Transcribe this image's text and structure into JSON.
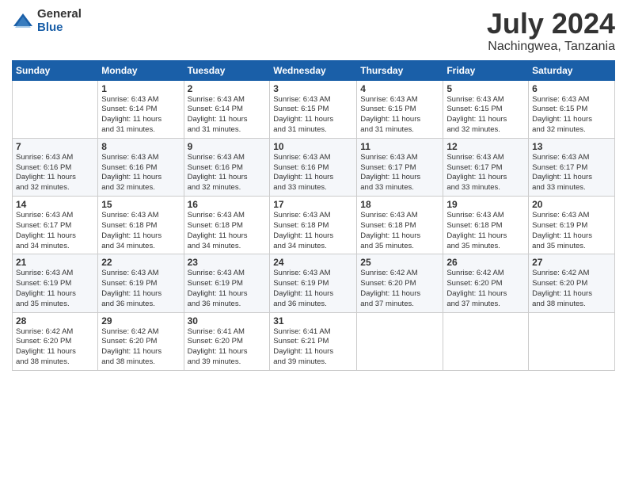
{
  "logo": {
    "general": "General",
    "blue": "Blue"
  },
  "title": "July 2024",
  "location": "Nachingwea, Tanzania",
  "weekdays": [
    "Sunday",
    "Monday",
    "Tuesday",
    "Wednesday",
    "Thursday",
    "Friday",
    "Saturday"
  ],
  "weeks": [
    [
      {
        "day": "",
        "sunrise": "",
        "sunset": "",
        "daylight": ""
      },
      {
        "day": "1",
        "sunrise": "Sunrise: 6:43 AM",
        "sunset": "Sunset: 6:14 PM",
        "daylight": "Daylight: 11 hours and 31 minutes."
      },
      {
        "day": "2",
        "sunrise": "Sunrise: 6:43 AM",
        "sunset": "Sunset: 6:14 PM",
        "daylight": "Daylight: 11 hours and 31 minutes."
      },
      {
        "day": "3",
        "sunrise": "Sunrise: 6:43 AM",
        "sunset": "Sunset: 6:15 PM",
        "daylight": "Daylight: 11 hours and 31 minutes."
      },
      {
        "day": "4",
        "sunrise": "Sunrise: 6:43 AM",
        "sunset": "Sunset: 6:15 PM",
        "daylight": "Daylight: 11 hours and 31 minutes."
      },
      {
        "day": "5",
        "sunrise": "Sunrise: 6:43 AM",
        "sunset": "Sunset: 6:15 PM",
        "daylight": "Daylight: 11 hours and 32 minutes."
      },
      {
        "day": "6",
        "sunrise": "Sunrise: 6:43 AM",
        "sunset": "Sunset: 6:15 PM",
        "daylight": "Daylight: 11 hours and 32 minutes."
      }
    ],
    [
      {
        "day": "7",
        "sunrise": "Sunrise: 6:43 AM",
        "sunset": "Sunset: 6:16 PM",
        "daylight": "Daylight: 11 hours and 32 minutes."
      },
      {
        "day": "8",
        "sunrise": "Sunrise: 6:43 AM",
        "sunset": "Sunset: 6:16 PM",
        "daylight": "Daylight: 11 hours and 32 minutes."
      },
      {
        "day": "9",
        "sunrise": "Sunrise: 6:43 AM",
        "sunset": "Sunset: 6:16 PM",
        "daylight": "Daylight: 11 hours and 32 minutes."
      },
      {
        "day": "10",
        "sunrise": "Sunrise: 6:43 AM",
        "sunset": "Sunset: 6:16 PM",
        "daylight": "Daylight: 11 hours and 33 minutes."
      },
      {
        "day": "11",
        "sunrise": "Sunrise: 6:43 AM",
        "sunset": "Sunset: 6:17 PM",
        "daylight": "Daylight: 11 hours and 33 minutes."
      },
      {
        "day": "12",
        "sunrise": "Sunrise: 6:43 AM",
        "sunset": "Sunset: 6:17 PM",
        "daylight": "Daylight: 11 hours and 33 minutes."
      },
      {
        "day": "13",
        "sunrise": "Sunrise: 6:43 AM",
        "sunset": "Sunset: 6:17 PM",
        "daylight": "Daylight: 11 hours and 33 minutes."
      }
    ],
    [
      {
        "day": "14",
        "sunrise": "Sunrise: 6:43 AM",
        "sunset": "Sunset: 6:17 PM",
        "daylight": "Daylight: 11 hours and 34 minutes."
      },
      {
        "day": "15",
        "sunrise": "Sunrise: 6:43 AM",
        "sunset": "Sunset: 6:18 PM",
        "daylight": "Daylight: 11 hours and 34 minutes."
      },
      {
        "day": "16",
        "sunrise": "Sunrise: 6:43 AM",
        "sunset": "Sunset: 6:18 PM",
        "daylight": "Daylight: 11 hours and 34 minutes."
      },
      {
        "day": "17",
        "sunrise": "Sunrise: 6:43 AM",
        "sunset": "Sunset: 6:18 PM",
        "daylight": "Daylight: 11 hours and 34 minutes."
      },
      {
        "day": "18",
        "sunrise": "Sunrise: 6:43 AM",
        "sunset": "Sunset: 6:18 PM",
        "daylight": "Daylight: 11 hours and 35 minutes."
      },
      {
        "day": "19",
        "sunrise": "Sunrise: 6:43 AM",
        "sunset": "Sunset: 6:18 PM",
        "daylight": "Daylight: 11 hours and 35 minutes."
      },
      {
        "day": "20",
        "sunrise": "Sunrise: 6:43 AM",
        "sunset": "Sunset: 6:19 PM",
        "daylight": "Daylight: 11 hours and 35 minutes."
      }
    ],
    [
      {
        "day": "21",
        "sunrise": "Sunrise: 6:43 AM",
        "sunset": "Sunset: 6:19 PM",
        "daylight": "Daylight: 11 hours and 35 minutes."
      },
      {
        "day": "22",
        "sunrise": "Sunrise: 6:43 AM",
        "sunset": "Sunset: 6:19 PM",
        "daylight": "Daylight: 11 hours and 36 minutes."
      },
      {
        "day": "23",
        "sunrise": "Sunrise: 6:43 AM",
        "sunset": "Sunset: 6:19 PM",
        "daylight": "Daylight: 11 hours and 36 minutes."
      },
      {
        "day": "24",
        "sunrise": "Sunrise: 6:43 AM",
        "sunset": "Sunset: 6:19 PM",
        "daylight": "Daylight: 11 hours and 36 minutes."
      },
      {
        "day": "25",
        "sunrise": "Sunrise: 6:42 AM",
        "sunset": "Sunset: 6:20 PM",
        "daylight": "Daylight: 11 hours and 37 minutes."
      },
      {
        "day": "26",
        "sunrise": "Sunrise: 6:42 AM",
        "sunset": "Sunset: 6:20 PM",
        "daylight": "Daylight: 11 hours and 37 minutes."
      },
      {
        "day": "27",
        "sunrise": "Sunrise: 6:42 AM",
        "sunset": "Sunset: 6:20 PM",
        "daylight": "Daylight: 11 hours and 38 minutes."
      }
    ],
    [
      {
        "day": "28",
        "sunrise": "Sunrise: 6:42 AM",
        "sunset": "Sunset: 6:20 PM",
        "daylight": "Daylight: 11 hours and 38 minutes."
      },
      {
        "day": "29",
        "sunrise": "Sunrise: 6:42 AM",
        "sunset": "Sunset: 6:20 PM",
        "daylight": "Daylight: 11 hours and 38 minutes."
      },
      {
        "day": "30",
        "sunrise": "Sunrise: 6:41 AM",
        "sunset": "Sunset: 6:20 PM",
        "daylight": "Daylight: 11 hours and 39 minutes."
      },
      {
        "day": "31",
        "sunrise": "Sunrise: 6:41 AM",
        "sunset": "Sunset: 6:21 PM",
        "daylight": "Daylight: 11 hours and 39 minutes."
      },
      {
        "day": "",
        "sunrise": "",
        "sunset": "",
        "daylight": ""
      },
      {
        "day": "",
        "sunrise": "",
        "sunset": "",
        "daylight": ""
      },
      {
        "day": "",
        "sunrise": "",
        "sunset": "",
        "daylight": ""
      }
    ]
  ]
}
